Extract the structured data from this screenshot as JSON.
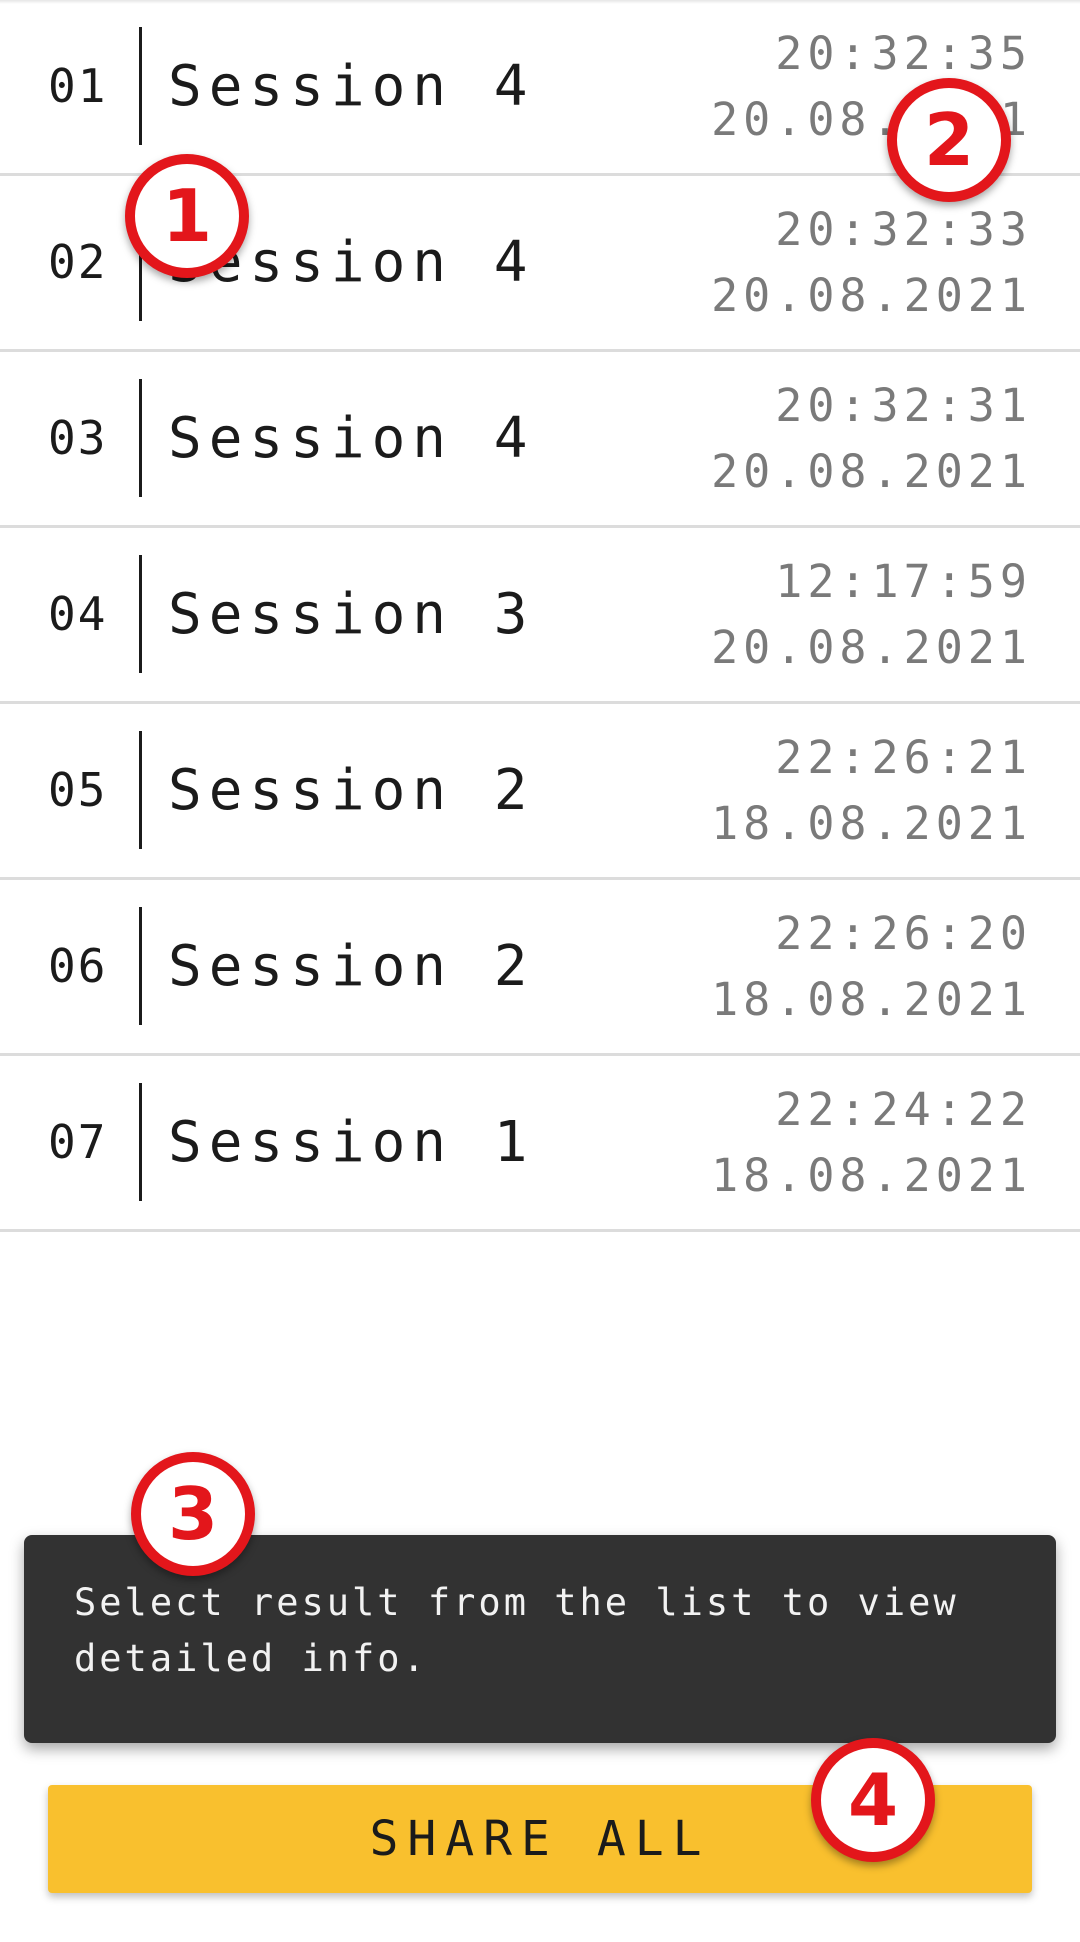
{
  "sessions": [
    {
      "index": "01",
      "title": "Session 4",
      "time": "20:32:35",
      "date": "20.08.2021"
    },
    {
      "index": "02",
      "title": "Session 4",
      "time": "20:32:33",
      "date": "20.08.2021"
    },
    {
      "index": "03",
      "title": "Session 4",
      "time": "20:32:31",
      "date": "20.08.2021"
    },
    {
      "index": "04",
      "title": "Session 3",
      "time": "12:17:59",
      "date": "20.08.2021"
    },
    {
      "index": "05",
      "title": "Session 2",
      "time": "22:26:21",
      "date": "18.08.2021"
    },
    {
      "index": "06",
      "title": "Session 2",
      "time": "22:26:20",
      "date": "18.08.2021"
    },
    {
      "index": "07",
      "title": "Session 1",
      "time": "22:24:22",
      "date": "18.08.2021"
    }
  ],
  "toast": {
    "message": "Select result from the list to view detailed info."
  },
  "share_button": {
    "label": "SHARE ALL"
  },
  "annotations": [
    "1",
    "2",
    "3",
    "4"
  ],
  "colors": {
    "accent": "#f9c02e",
    "toast_bg": "#323232",
    "annotation": "#e3161b",
    "secondary_text": "#7a7a7a"
  }
}
